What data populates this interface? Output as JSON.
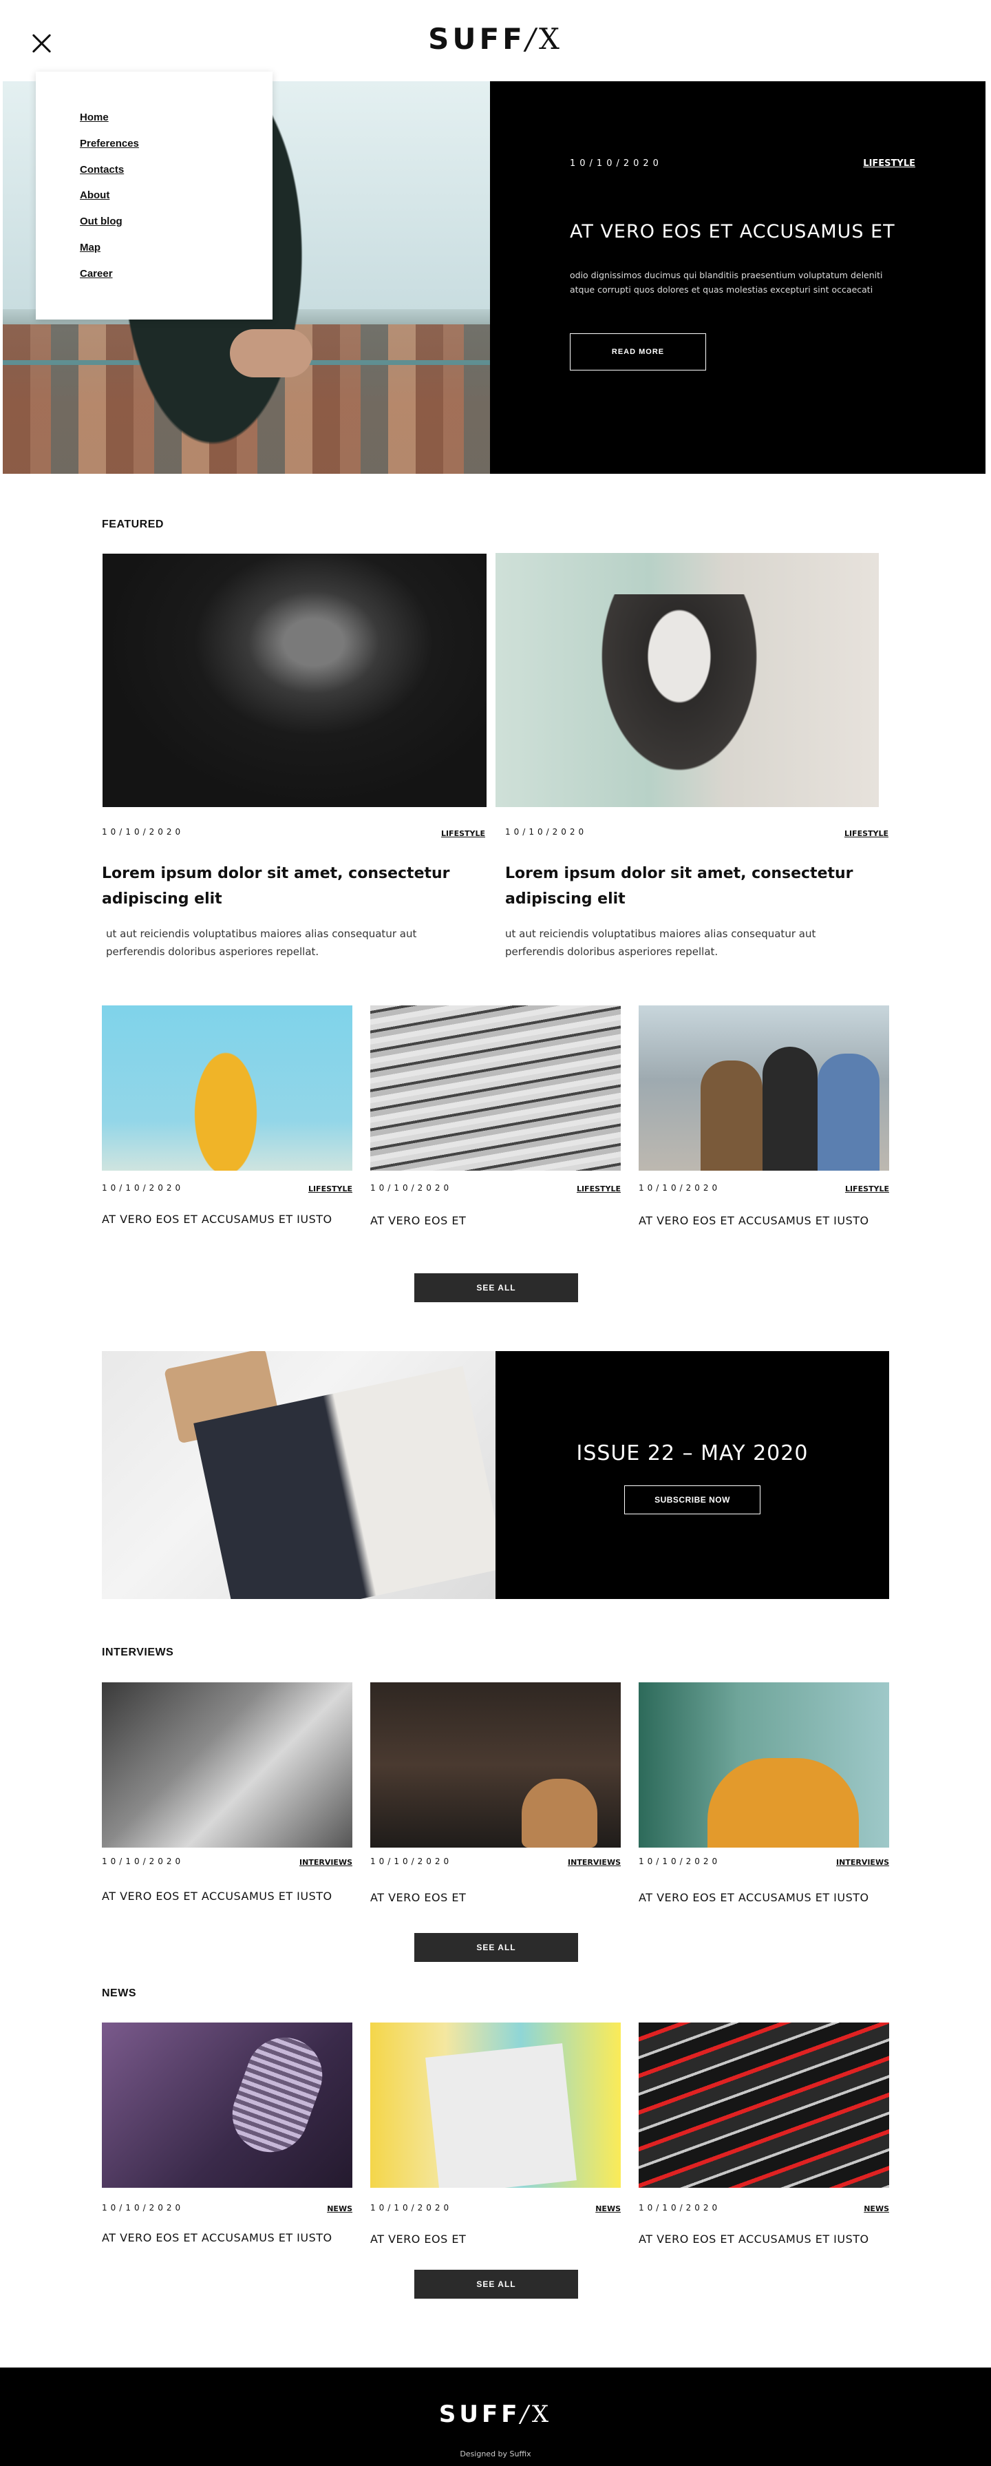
{
  "header": {
    "logo_main": "SUFF",
    "logo_slash": "/",
    "logo_tail": "X"
  },
  "menu": {
    "items": [
      {
        "label": "Home"
      },
      {
        "label": "Preferences"
      },
      {
        "label": "Contacts"
      },
      {
        "label": "About"
      },
      {
        "label": "Out blog"
      },
      {
        "label": "Map"
      },
      {
        "label": "Career"
      }
    ]
  },
  "hero": {
    "date": "10/10/2020",
    "category": "LIFESTYLE",
    "title": "AT VERO EOS ET ACCUSAMUS ET",
    "text": "odio dignissimos ducimus qui blanditiis praesentium voluptatum deleniti atque corrupti quos dolores et quas molestias excepturi sint occaecati",
    "button": "READ MORE"
  },
  "featured": {
    "heading": "FEATURED",
    "big": [
      {
        "date": "10/10/2020",
        "category": "LIFESTYLE",
        "title": "Lorem ipsum dolor sit amet, consectetur adipiscing elit",
        "text": "ut aut reiciendis voluptatibus maiores alias consequatur aut perferendis doloribus asperiores repellat."
      },
      {
        "date": "10/10/2020",
        "category": "LIFESTYLE",
        "title": "Lorem ipsum dolor sit amet, consectetur adipiscing elit",
        "text": "ut aut reiciendis voluptatibus maiores alias consequatur aut perferendis doloribus asperiores repellat."
      }
    ],
    "small": [
      {
        "date": "10/10/2020",
        "category": "LIFESTYLE",
        "title": "AT VERO EOS ET ACCUSAMUS ET IUSTO"
      },
      {
        "date": "10/10/2020",
        "category": "LIFESTYLE",
        "title": "AT VERO EOS ET"
      },
      {
        "date": "10/10/2020",
        "category": "LIFESTYLE",
        "title": "AT VERO EOS ET ACCUSAMUS ET IUSTO"
      }
    ],
    "see_all": "SEE ALL"
  },
  "issue": {
    "title": "ISSUE 22 – MAY 2020",
    "button": "SUBSCRIBE NOW"
  },
  "interviews": {
    "heading": "INTERVIEWS",
    "cards": [
      {
        "date": "10/10/2020",
        "category": "INTERVIEWS",
        "title": "AT VERO EOS ET ACCUSAMUS ET IUSTO"
      },
      {
        "date": "10/10/2020",
        "category": "INTERVIEWS",
        "title": "AT VERO EOS ET"
      },
      {
        "date": "10/10/2020",
        "category": "INTERVIEWS",
        "title": "AT VERO EOS ET ACCUSAMUS ET IUSTO"
      }
    ],
    "see_all": "SEE ALL"
  },
  "news": {
    "heading": "NEWS",
    "cards": [
      {
        "date": "10/10/2020",
        "category": "NEWS",
        "title": "AT VERO EOS ET ACCUSAMUS ET IUSTO"
      },
      {
        "date": "10/10/2020",
        "category": "NEWS",
        "title": "AT VERO EOS ET"
      },
      {
        "date": "10/10/2020",
        "category": "NEWS",
        "title": "AT VERO EOS ET ACCUSAMUS ET IUSTO"
      }
    ],
    "see_all": "SEE ALL"
  },
  "footer": {
    "logo_main": "SUFF",
    "logo_slash": "/",
    "logo_tail": "X",
    "credit": "Designed by Suffix"
  },
  "colors": {
    "primary": "#000000",
    "button_dark": "#2b2b2b",
    "background": "#ffffff"
  },
  "icons": {
    "close": "close-icon"
  }
}
